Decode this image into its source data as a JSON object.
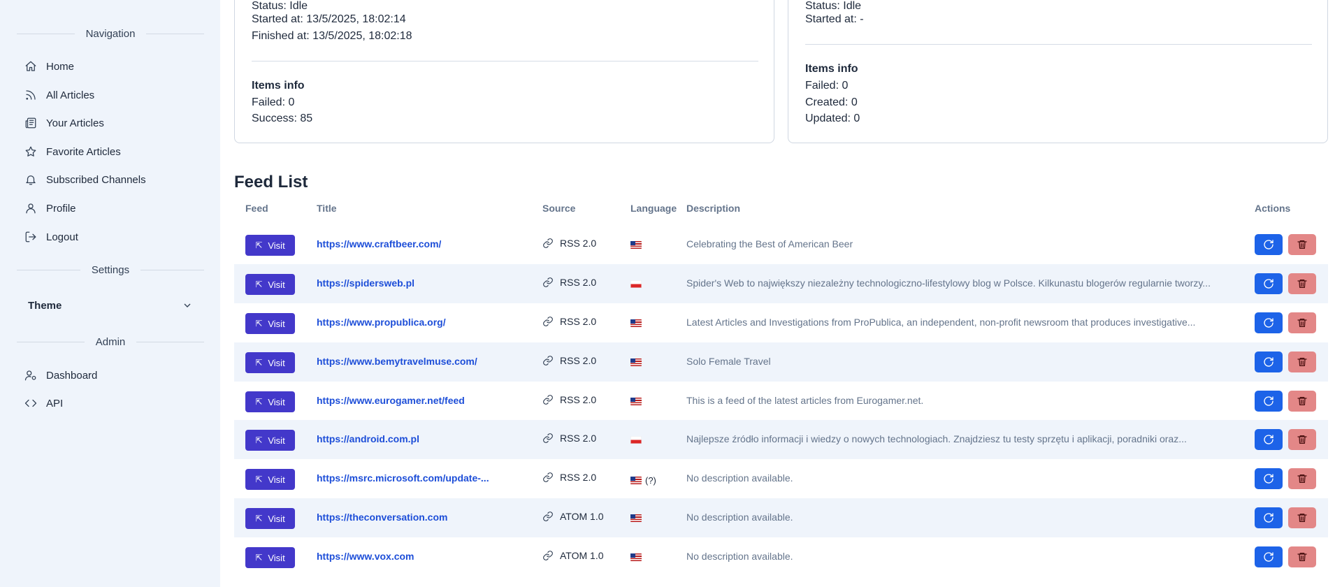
{
  "sidebar": {
    "navigation_heading": "Navigation",
    "settings_heading": "Settings",
    "admin_heading": "Admin",
    "items": [
      {
        "label": "Home",
        "icon": "home-icon"
      },
      {
        "label": "All Articles",
        "icon": "rss-icon"
      },
      {
        "label": "Your Articles",
        "icon": "newspaper-icon"
      },
      {
        "label": "Favorite Articles",
        "icon": "star-icon"
      },
      {
        "label": "Subscribed Channels",
        "icon": "bell-icon"
      },
      {
        "label": "Profile",
        "icon": "user-icon"
      },
      {
        "label": "Logout",
        "icon": "logout-icon"
      }
    ],
    "theme_label": "Theme",
    "admin_items": [
      {
        "label": "Dashboard",
        "icon": "user-cog-icon"
      },
      {
        "label": "API",
        "icon": "code-icon"
      }
    ]
  },
  "card_left": {
    "status_label": "Status:",
    "status_value": "Idle",
    "started_label": "Started at:",
    "started_value": "13/5/2025, 18:02:14",
    "finished_label": "Finished at:",
    "finished_value": "13/5/2025, 18:02:18",
    "items_heading": "Items info",
    "failed_label": "Failed:",
    "failed_value": "0",
    "success_label": "Success:",
    "success_value": "85"
  },
  "card_right": {
    "status_label": "Status:",
    "status_value": "Idle",
    "started_label": "Started at:",
    "started_value": "-",
    "items_heading": "Items info",
    "failed_label": "Failed:",
    "failed_value": "0",
    "created_label": "Created:",
    "created_value": "0",
    "updated_label": "Updated:",
    "updated_value": "0"
  },
  "feed_list": {
    "title": "Feed List",
    "columns": {
      "feed": "Feed",
      "title": "Title",
      "source": "Source",
      "language": "Language",
      "description": "Description",
      "actions": "Actions"
    },
    "visit_label": "Visit",
    "rows": [
      {
        "title": "https://www.craftbeer.com/",
        "source": "RSS 2.0",
        "flag": "us",
        "lang_extra": "",
        "description": "Celebrating the Best of American Beer"
      },
      {
        "title": "https://spidersweb.pl",
        "source": "RSS 2.0",
        "flag": "pl",
        "lang_extra": "",
        "description": "Spider's Web to największy niezależny technologiczno-lifestylowy blog w Polsce. Kilkunastu blogerów regularnie tworzy..."
      },
      {
        "title": "https://www.propublica.org/",
        "source": "RSS 2.0",
        "flag": "us",
        "lang_extra": "",
        "description": "Latest Articles and Investigations from ProPublica, an independent, non-profit newsroom that produces investigative..."
      },
      {
        "title": "https://www.bemytravelmuse.com/",
        "source": "RSS 2.0",
        "flag": "us",
        "lang_extra": "",
        "description": "Solo Female Travel"
      },
      {
        "title": "https://www.eurogamer.net/feed",
        "source": "RSS 2.0",
        "flag": "us",
        "lang_extra": "",
        "description": "This is a feed of the latest articles from Eurogamer.net."
      },
      {
        "title": "https://android.com.pl",
        "source": "RSS 2.0",
        "flag": "pl",
        "lang_extra": "",
        "description": "Najlepsze źródło informacji i wiedzy o nowych technologiach. Znajdziesz tu testy sprzętu i aplikacji, poradniki oraz..."
      },
      {
        "title": "https://msrc.microsoft.com/update-...",
        "source": "RSS 2.0",
        "flag": "us",
        "lang_extra": "(?)",
        "description": "No description available."
      },
      {
        "title": "https://theconversation.com",
        "source": "ATOM 1.0",
        "flag": "us",
        "lang_extra": "",
        "description": "No description available."
      },
      {
        "title": "https://www.vox.com",
        "source": "ATOM 1.0",
        "flag": "us",
        "lang_extra": "",
        "description": "No description available."
      }
    ]
  }
}
